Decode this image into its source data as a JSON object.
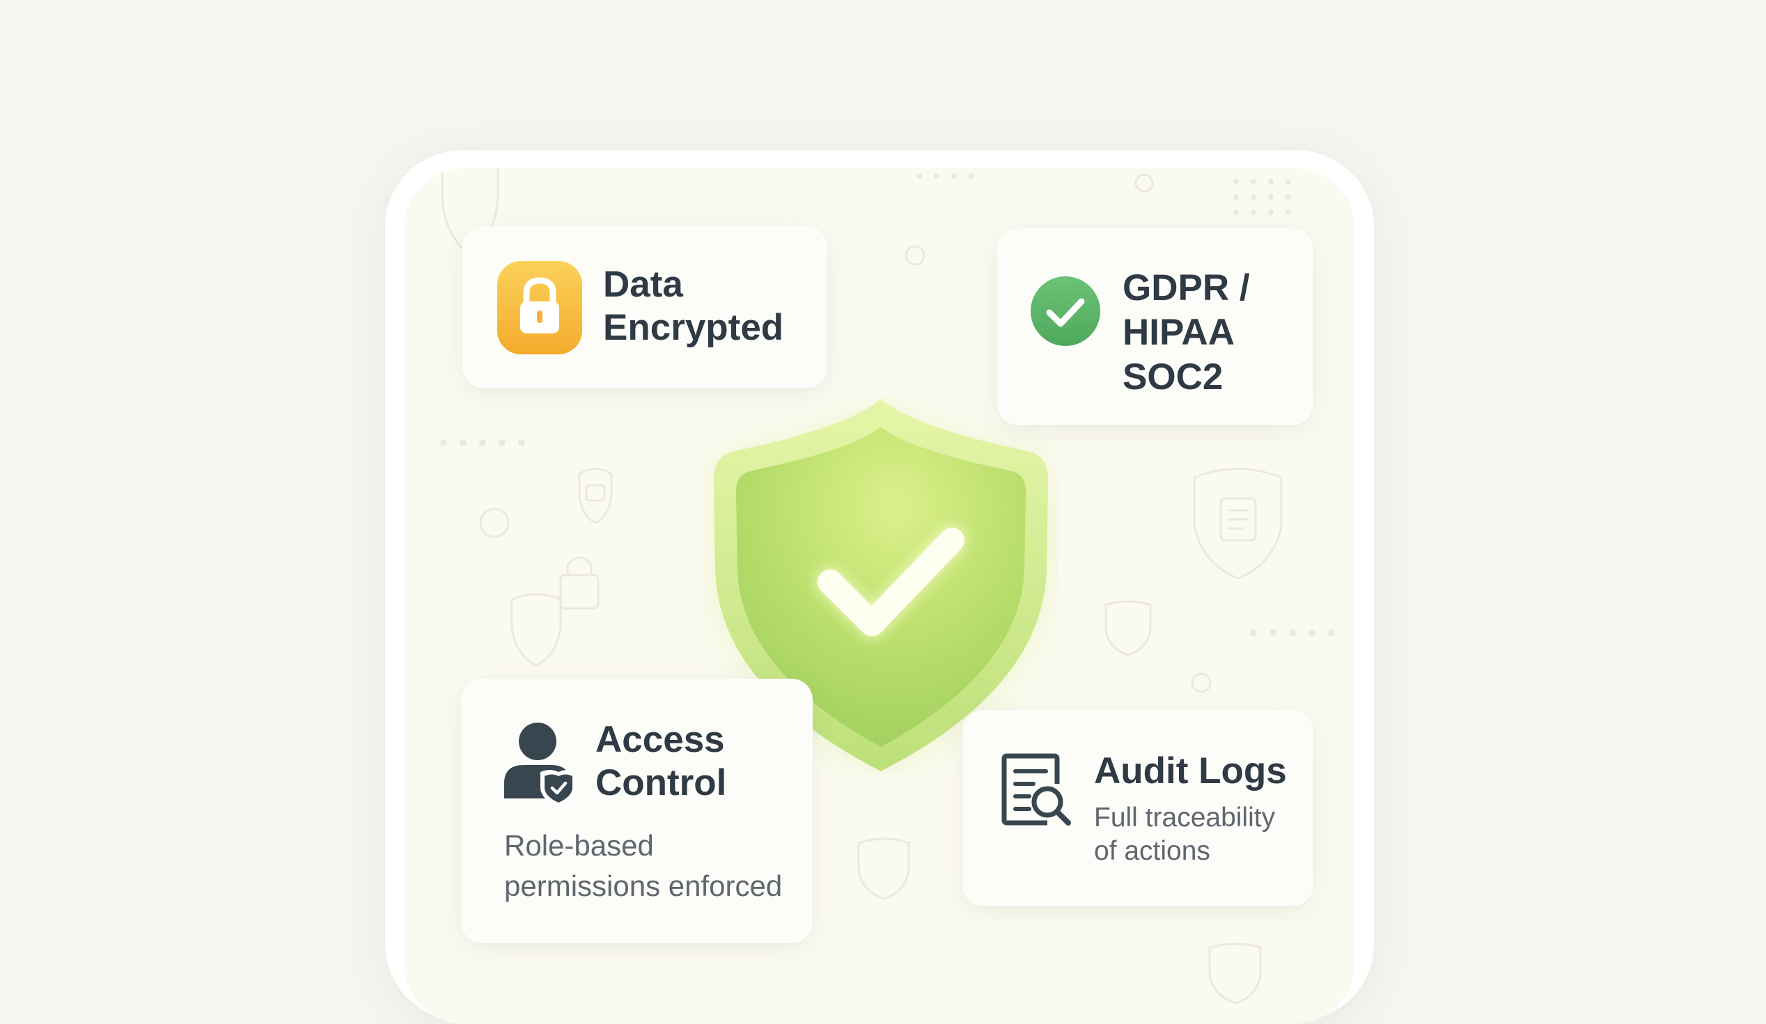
{
  "cards": {
    "encrypted": {
      "title": "Data\nEncrypted",
      "icon": "lock-icon"
    },
    "compliance": {
      "title": "GDPR /\nHIPAA\nSOC2",
      "icon": "check-circle-icon"
    },
    "access": {
      "title": "Access\nControl",
      "subtitle": "Role-based\npermissions enforced",
      "icon": "user-shield-icon"
    },
    "audit": {
      "title": "Audit Logs",
      "subtitle": "Full traceability\nof actions",
      "icon": "document-search-icon"
    }
  },
  "hero": {
    "icon": "shield-check-icon"
  },
  "colors": {
    "background": "#f6f5f1",
    "lock_badge": "#f7b833",
    "check_badge": "#5fb86a",
    "shield_green": "#a6d65c",
    "text_dark": "#2f3a44"
  }
}
